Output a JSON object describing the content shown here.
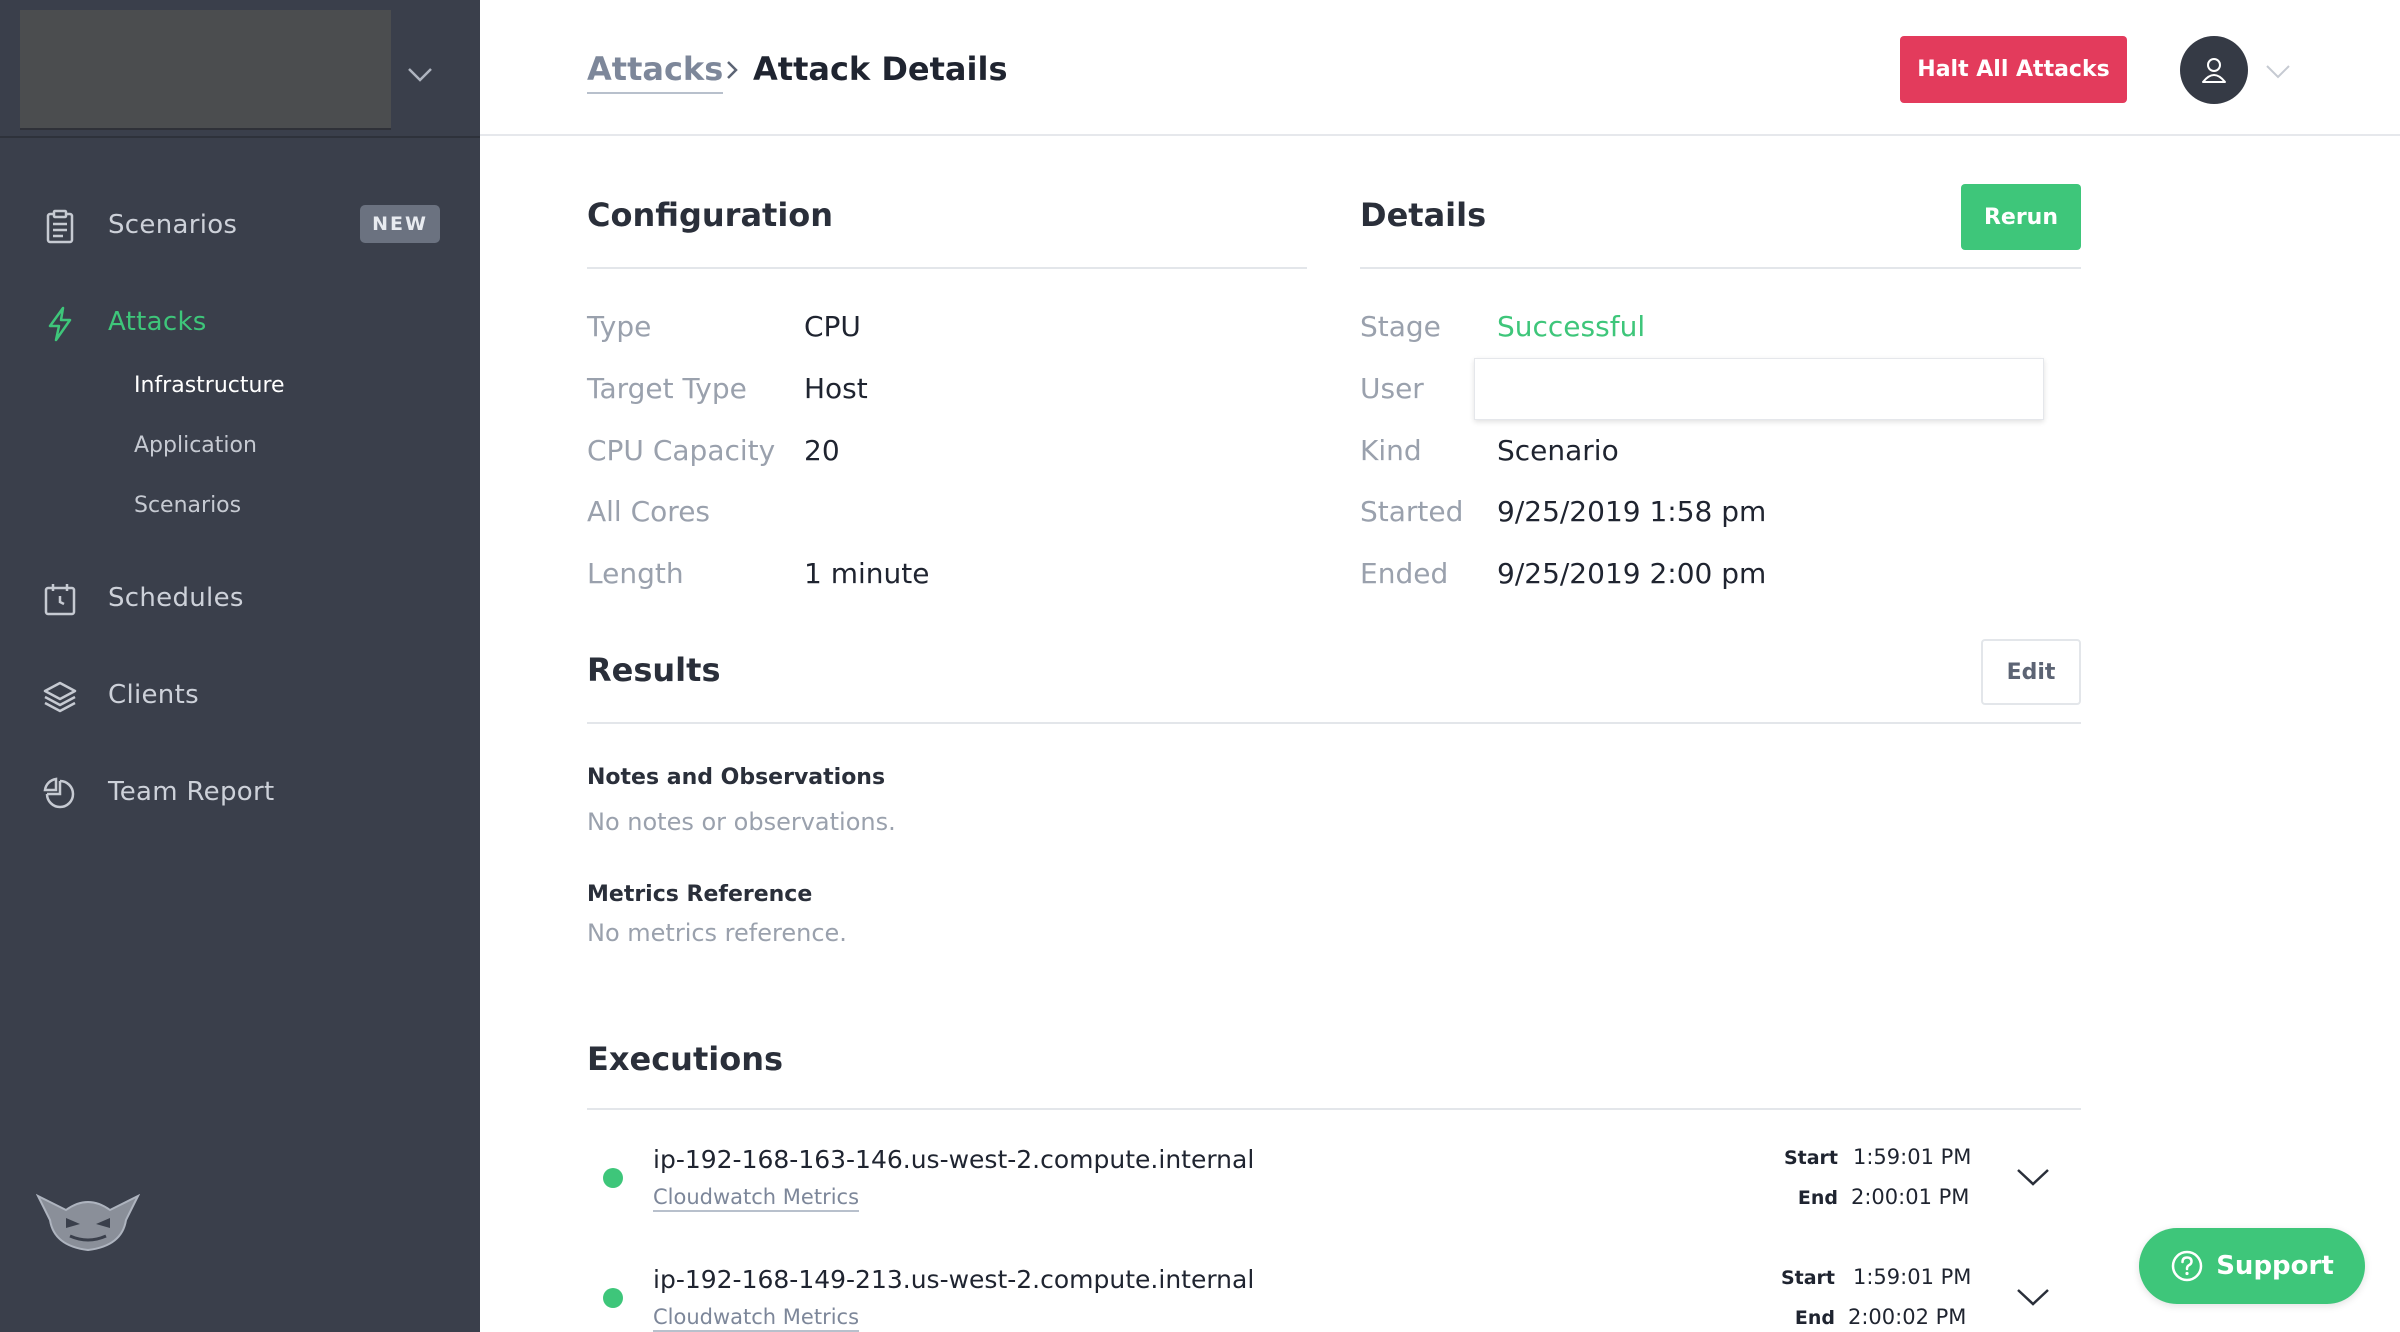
{
  "sidebar": {
    "nav": [
      {
        "label": "Scenarios",
        "icon": "clipboard-icon",
        "badge": "NEW"
      },
      {
        "label": "Attacks",
        "icon": "lightning-icon",
        "active": true
      },
      {
        "label": "Schedules",
        "icon": "calendar-icon"
      },
      {
        "label": "Clients",
        "icon": "layers-icon"
      },
      {
        "label": "Team Report",
        "icon": "pie-chart-icon"
      }
    ],
    "attack_subnav": [
      "Infrastructure",
      "Application",
      "Scenarios"
    ],
    "logo_icon": "gremlin-logo-icon"
  },
  "header": {
    "breadcrumb_parent": "Attacks",
    "breadcrumb_current": "Attack Details",
    "halt_button": "Halt All Attacks"
  },
  "configuration": {
    "title": "Configuration",
    "rows": [
      {
        "label": "Type",
        "value": "CPU"
      },
      {
        "label": "Target Type",
        "value": "Host"
      },
      {
        "label": "CPU Capacity",
        "value": "20"
      },
      {
        "label": "All Cores",
        "value": ""
      },
      {
        "label": "Length",
        "value": "1 minute"
      }
    ]
  },
  "details": {
    "title": "Details",
    "rerun_button": "Rerun",
    "rows": [
      {
        "label": "Stage",
        "value": "Successful"
      },
      {
        "label": "User",
        "value": ""
      },
      {
        "label": "Kind",
        "value": "Scenario"
      },
      {
        "label": "Started",
        "value": "9/25/2019 1:58 pm"
      },
      {
        "label": "Ended",
        "value": "9/25/2019 2:00 pm"
      }
    ]
  },
  "results": {
    "title": "Results",
    "edit_button": "Edit",
    "notes_heading": "Notes and Observations",
    "notes_text": "No notes or observations.",
    "metrics_heading": "Metrics Reference",
    "metrics_text": "No metrics reference."
  },
  "executions": {
    "title": "Executions",
    "items": [
      {
        "host": "ip-192-168-163-146.us-west-2.compute.internal",
        "link": "Cloudwatch Metrics",
        "start_label": "Start",
        "start": "1:59:01 PM",
        "end_label": "End",
        "end": "2:00:01 PM"
      },
      {
        "host": "ip-192-168-149-213.us-west-2.compute.internal",
        "link": "Cloudwatch Metrics",
        "start_label": "Start",
        "start": "1:59:01 PM",
        "end_label": "End",
        "end": "2:00:02 PM"
      }
    ]
  },
  "support_button": "Support",
  "colors": {
    "sidebar_bg": "#3a3f4b",
    "accent_green": "#3ec67a",
    "danger_red": "#e33b5c"
  }
}
